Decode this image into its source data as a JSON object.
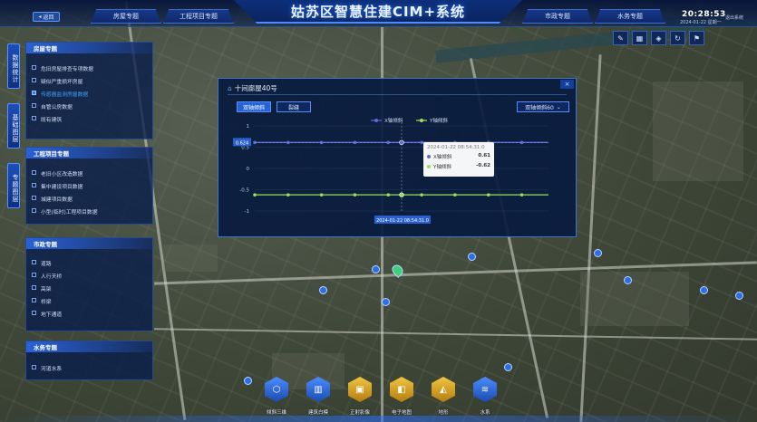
{
  "header": {
    "title": "姑苏区智慧住建CIM+系统",
    "back_label": "返回",
    "tabs": [
      "房屋专题",
      "工程项目专题",
      "市政专题",
      "水务专题"
    ],
    "time": "20:28:53",
    "date": "2024-01-22 星期一",
    "exit_label": "退出系统"
  },
  "toolbar": {
    "tools": [
      "pencil-icon",
      "grid-icon",
      "layers-icon",
      "rotate-icon",
      "flag-icon"
    ]
  },
  "side_tabs": [
    "数据统计",
    "基础图层",
    "专题图层"
  ],
  "panel": {
    "sections": [
      {
        "title": "房屋专题",
        "items": [
          {
            "label": "危旧房屋排查专项数据",
            "checked": false
          },
          {
            "label": "疑似严重损坏房屋",
            "checked": false
          },
          {
            "label": "传感器监测房屋数据",
            "checked": true
          },
          {
            "label": "自管公房数据",
            "checked": false
          },
          {
            "label": "既有建筑",
            "checked": false
          }
        ]
      },
      {
        "title": "工程项目专题",
        "items": [
          {
            "label": "老旧小区改造数据",
            "checked": false
          },
          {
            "label": "集中建设项目数据",
            "checked": false
          },
          {
            "label": "城建项目数据",
            "checked": false
          },
          {
            "label": "小型(临时)工程项目数据",
            "checked": false
          }
        ]
      },
      {
        "title": "市政专题",
        "items": [
          {
            "label": "道路",
            "checked": false
          },
          {
            "label": "人行天桥",
            "checked": false
          },
          {
            "label": "高架",
            "checked": false
          },
          {
            "label": "桥梁",
            "checked": false
          },
          {
            "label": "地下通道",
            "checked": false
          }
        ]
      },
      {
        "title": "水务专题",
        "items": [
          {
            "label": "河道水系",
            "checked": false
          }
        ]
      }
    ]
  },
  "popup": {
    "title": "十间廊屋40号",
    "close_label": "×",
    "buttons": {
      "tilt": "双轴倾斜",
      "crack": "裂缝",
      "range": "双轴倾斜60"
    },
    "tooltip": {
      "time": "2024-01-22 08:54:31.0",
      "rows": [
        {
          "name": "X轴倾斜",
          "value": "0.61"
        },
        {
          "name": "Y轴倾斜",
          "value": "-0.62"
        }
      ]
    },
    "y_highlight": "0.624",
    "x_highlight": "2024-01-22 08:54:31.0"
  },
  "chart_data": {
    "type": "line",
    "title": "",
    "xlabel": "",
    "ylabel": "",
    "ylim": [
      -1,
      1
    ],
    "y_ticks": [
      "1",
      "0.5",
      "0",
      "-0.5",
      "-1"
    ],
    "legend_position": "top",
    "grid": true,
    "series": [
      {
        "name": "X轴倾斜",
        "color": "#5b6bd6",
        "values": [
          0.61,
          0.61,
          0.61,
          0.61,
          0.61,
          0.61,
          0.61,
          0.61,
          0.61,
          0.61,
          0.61,
          0.61,
          0.61,
          0.61,
          0.61,
          0.61,
          0.61,
          0.61,
          0.61,
          0.61,
          0.61,
          0.61,
          0.61,
          0.61,
          0.61,
          0.61,
          0.61,
          0.61,
          0.61,
          0.61,
          0.61,
          0.61,
          0.61,
          0.61,
          0.61,
          0.61,
          0.61,
          0.61,
          0.61,
          0.61,
          0.61,
          0.61,
          0.61,
          0.61,
          0.61
        ]
      },
      {
        "name": "Y轴倾斜",
        "color": "#9be05c",
        "values": [
          -0.62,
          -0.62,
          -0.62,
          -0.62,
          -0.62,
          -0.62,
          -0.62,
          -0.62,
          -0.62,
          -0.62,
          -0.62,
          -0.62,
          -0.62,
          -0.62,
          -0.62,
          -0.62,
          -0.62,
          -0.62,
          -0.62,
          -0.62,
          -0.62,
          -0.62,
          -0.62,
          -0.62,
          -0.62,
          -0.62,
          -0.62,
          -0.62,
          -0.62,
          -0.62,
          -0.62,
          -0.62,
          -0.62,
          -0.62,
          -0.62,
          -0.62,
          -0.62,
          -0.62,
          -0.62,
          -0.62,
          -0.62,
          -0.62,
          -0.62,
          -0.62,
          -0.62
        ]
      }
    ],
    "marker_every": 5,
    "highlight_index": 22
  },
  "dock": {
    "items": [
      {
        "label": "倾斜三维",
        "icon": "cube-icon",
        "style": "blue"
      },
      {
        "label": "建筑白模",
        "icon": "building-icon",
        "style": "blue"
      },
      {
        "label": "正射影像",
        "icon": "image-icon",
        "style": "gold"
      },
      {
        "label": "电子地图",
        "icon": "map-icon",
        "style": "gold"
      },
      {
        "label": "地形",
        "icon": "terrain-icon",
        "style": "gold"
      },
      {
        "label": "水系",
        "icon": "water-icon",
        "style": "blue"
      }
    ]
  }
}
